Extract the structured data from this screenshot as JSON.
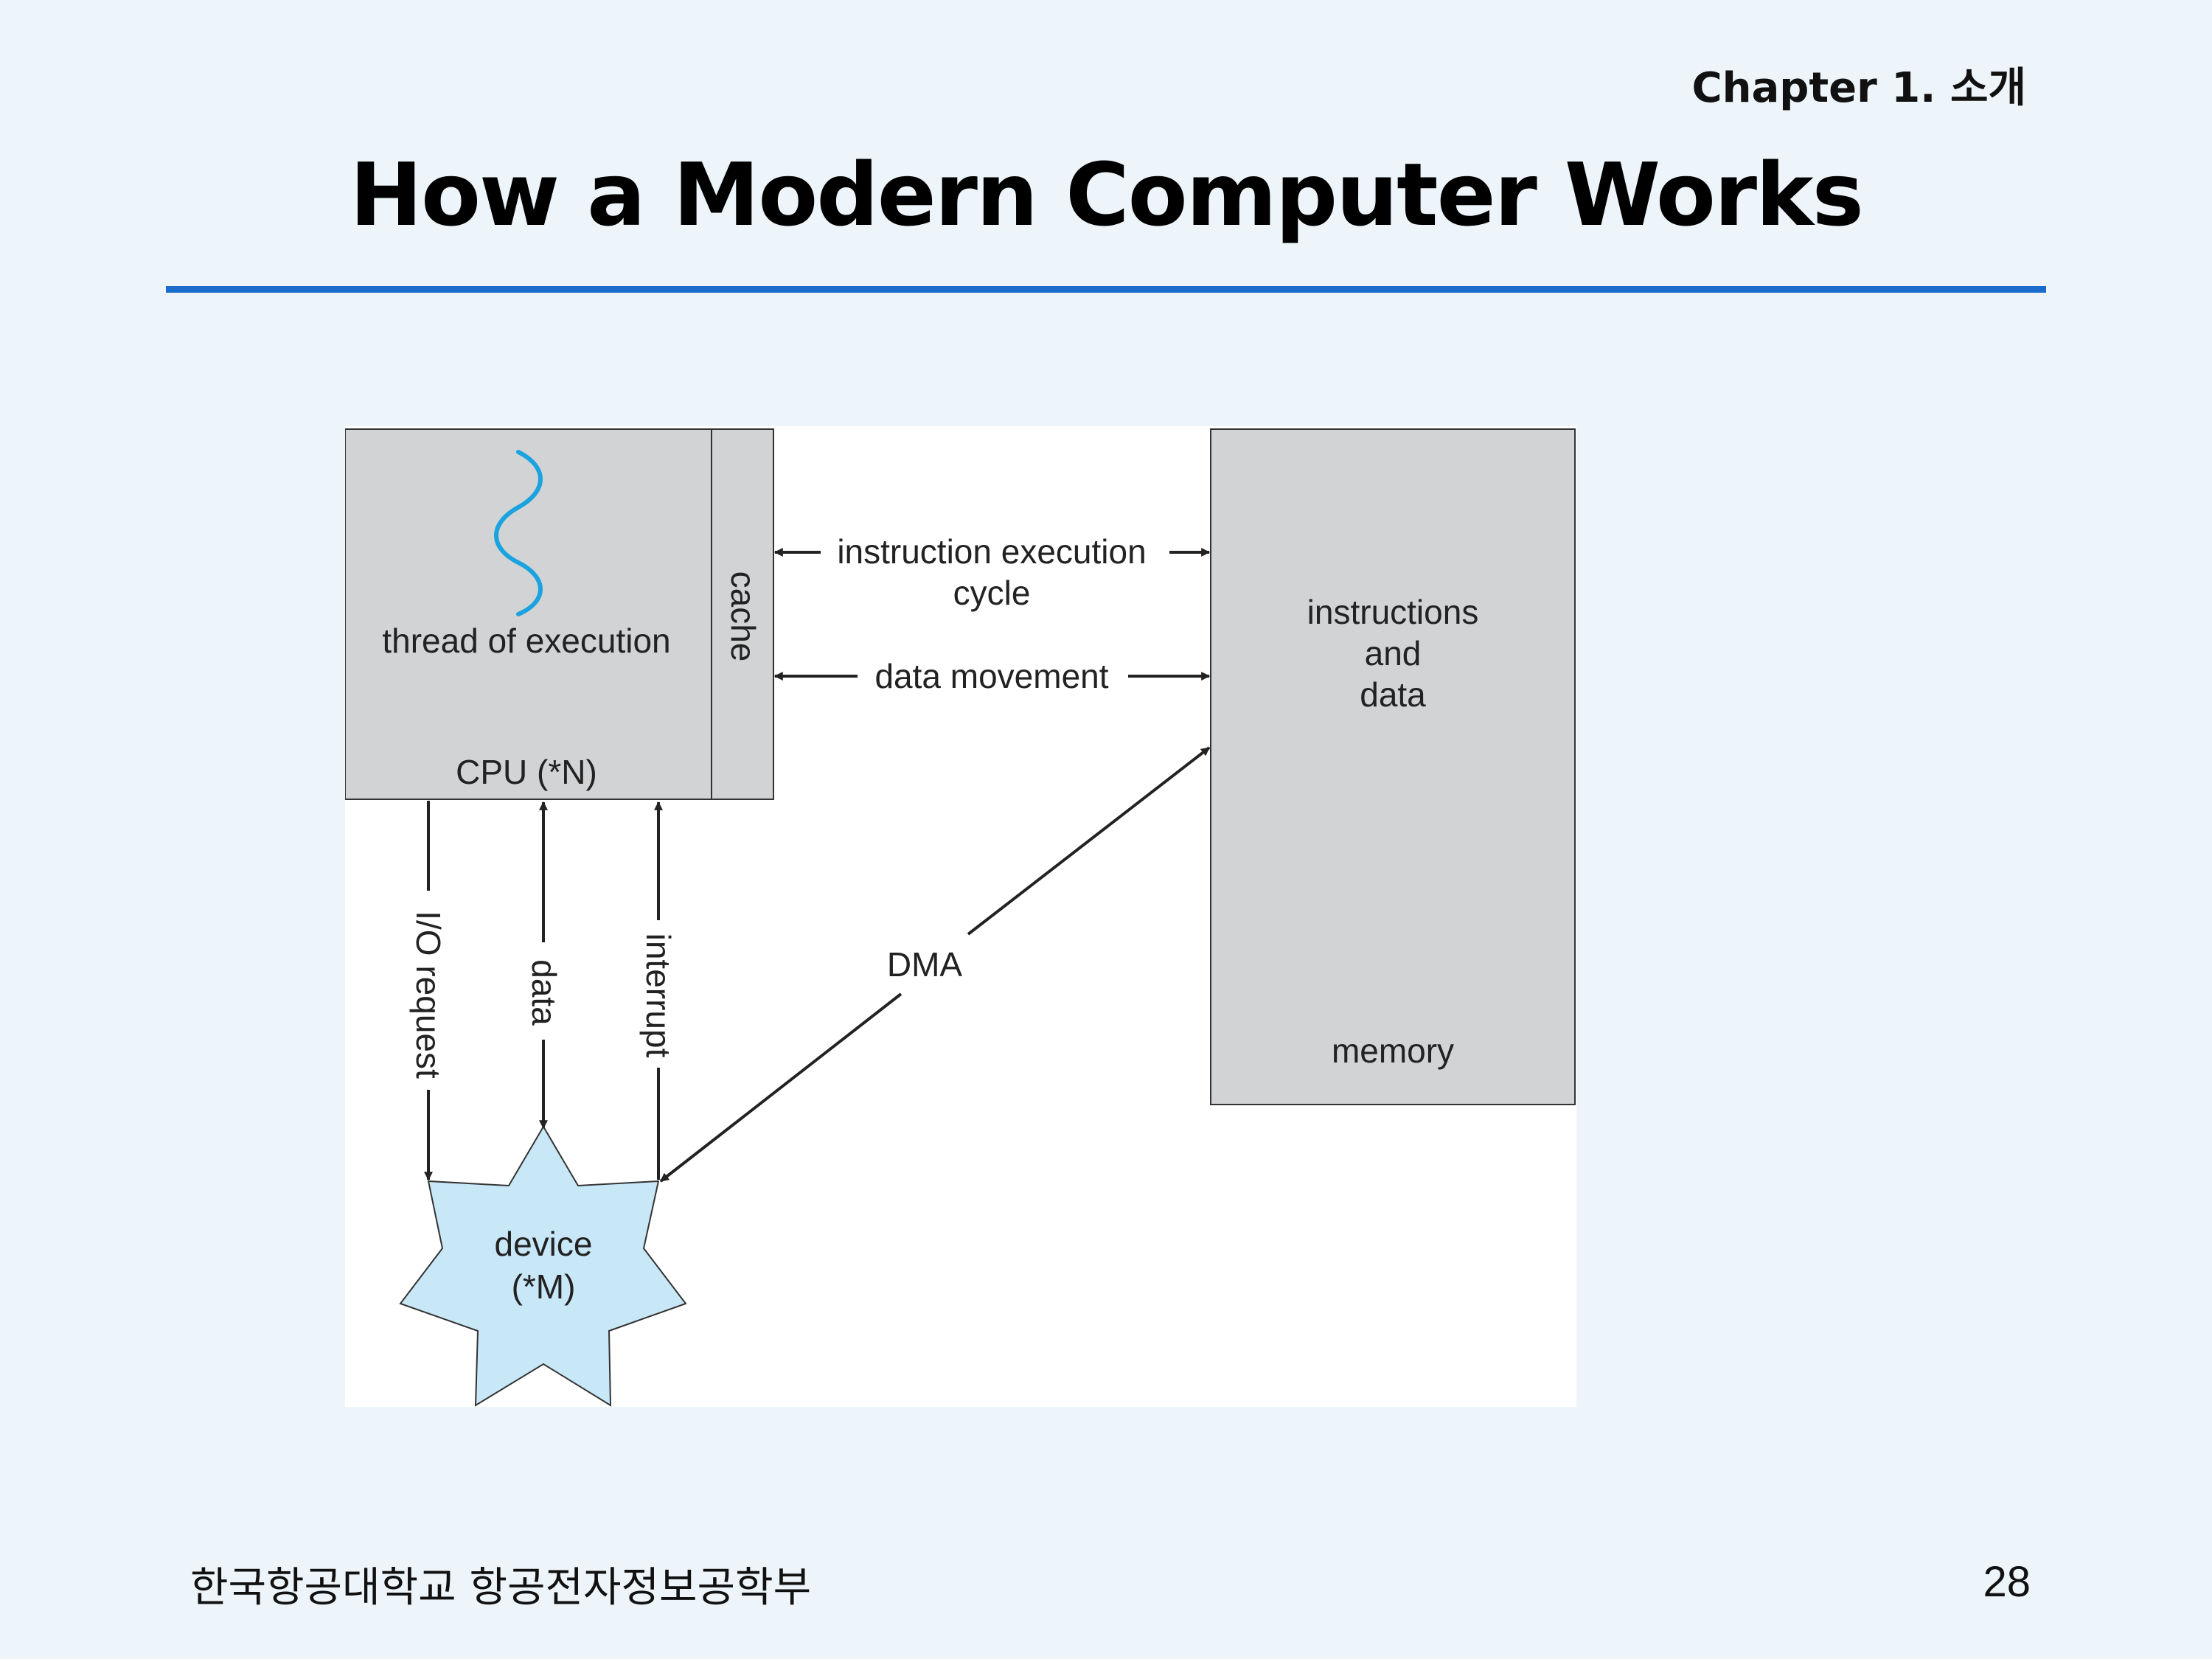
{
  "header": {
    "chapter": "Chapter 1.  소개",
    "title": "How a Modern Computer Works"
  },
  "diagram": {
    "cpu": {
      "thread_label": "thread of execution",
      "cpu_label": "CPU (*N)",
      "cache_label": "cache"
    },
    "memory": {
      "content_line1": "instructions",
      "content_line2": "and",
      "content_line3": "data",
      "label": "memory"
    },
    "arrows": {
      "instr_exec_line1": "instruction execution",
      "instr_exec_line2": "cycle",
      "data_movement": "data movement",
      "io_request": "I/O request",
      "data": "data",
      "interrupt": "interrupt",
      "dma": "DMA"
    },
    "device": {
      "line1": "device",
      "line2": "(*M)"
    },
    "colors": {
      "box_fill": "#d2d3d5",
      "thread_wave": "#1ba3e0",
      "device_fill": "#c8e7f7",
      "panel_bg": "#ffffff"
    }
  },
  "footer": {
    "institution": "한국항공대학교 항공전자정보공학부",
    "page_number": "28"
  }
}
